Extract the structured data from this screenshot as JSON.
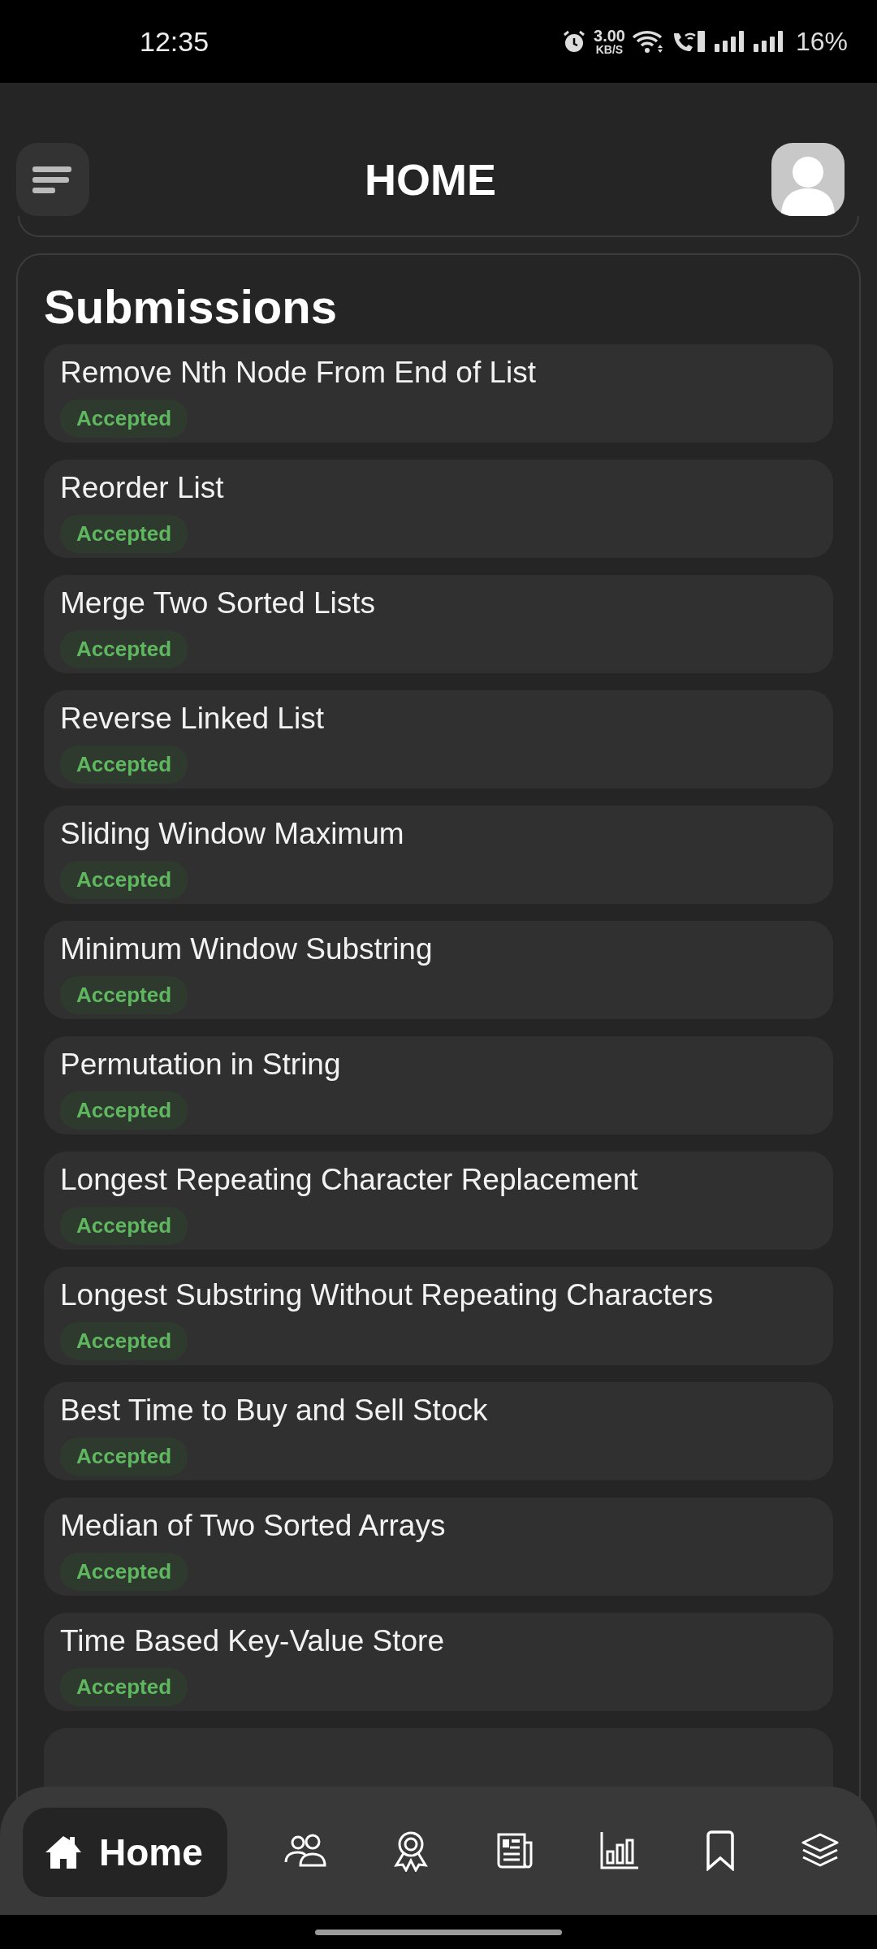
{
  "status_bar": {
    "time": "12:35",
    "net_speed": "3.00",
    "net_unit": "KB/S",
    "battery": "16%"
  },
  "header": {
    "title": "HOME"
  },
  "submissions": {
    "title": "Submissions",
    "items": [
      {
        "title": "Remove Nth Node From End of List",
        "status": "Accepted",
        "kind": "accepted"
      },
      {
        "title": "Reorder List",
        "status": "Accepted",
        "kind": "accepted"
      },
      {
        "title": "Merge Two Sorted Lists",
        "status": "Accepted",
        "kind": "accepted"
      },
      {
        "title": "Reverse Linked List",
        "status": "Accepted",
        "kind": "accepted"
      },
      {
        "title": "Sliding Window Maximum",
        "status": "Accepted",
        "kind": "accepted"
      },
      {
        "title": "Minimum Window Substring",
        "status": "Accepted",
        "kind": "accepted"
      },
      {
        "title": "Permutation in String",
        "status": "Accepted",
        "kind": "accepted"
      },
      {
        "title": "Longest Repeating Character Replacement",
        "status": "Accepted",
        "kind": "accepted"
      },
      {
        "title": "Longest Substring Without Repeating Characters",
        "status": "Accepted",
        "kind": "accepted"
      },
      {
        "title": "Best Time to Buy and Sell Stock",
        "status": "Accepted",
        "kind": "accepted"
      },
      {
        "title": "Median of Two Sorted Arrays",
        "status": "Accepted",
        "kind": "accepted"
      },
      {
        "title": "Time Based Key-Value Store",
        "status": "Accepted",
        "kind": "accepted"
      }
    ]
  },
  "nav": [
    {
      "kind": "home",
      "label": "Home",
      "selected": true
    },
    {
      "kind": "people",
      "selected": false
    },
    {
      "kind": "award",
      "selected": false
    },
    {
      "kind": "news",
      "selected": false
    },
    {
      "kind": "chart",
      "selected": false
    },
    {
      "kind": "bookmark",
      "selected": false
    },
    {
      "kind": "layers",
      "selected": false
    }
  ]
}
